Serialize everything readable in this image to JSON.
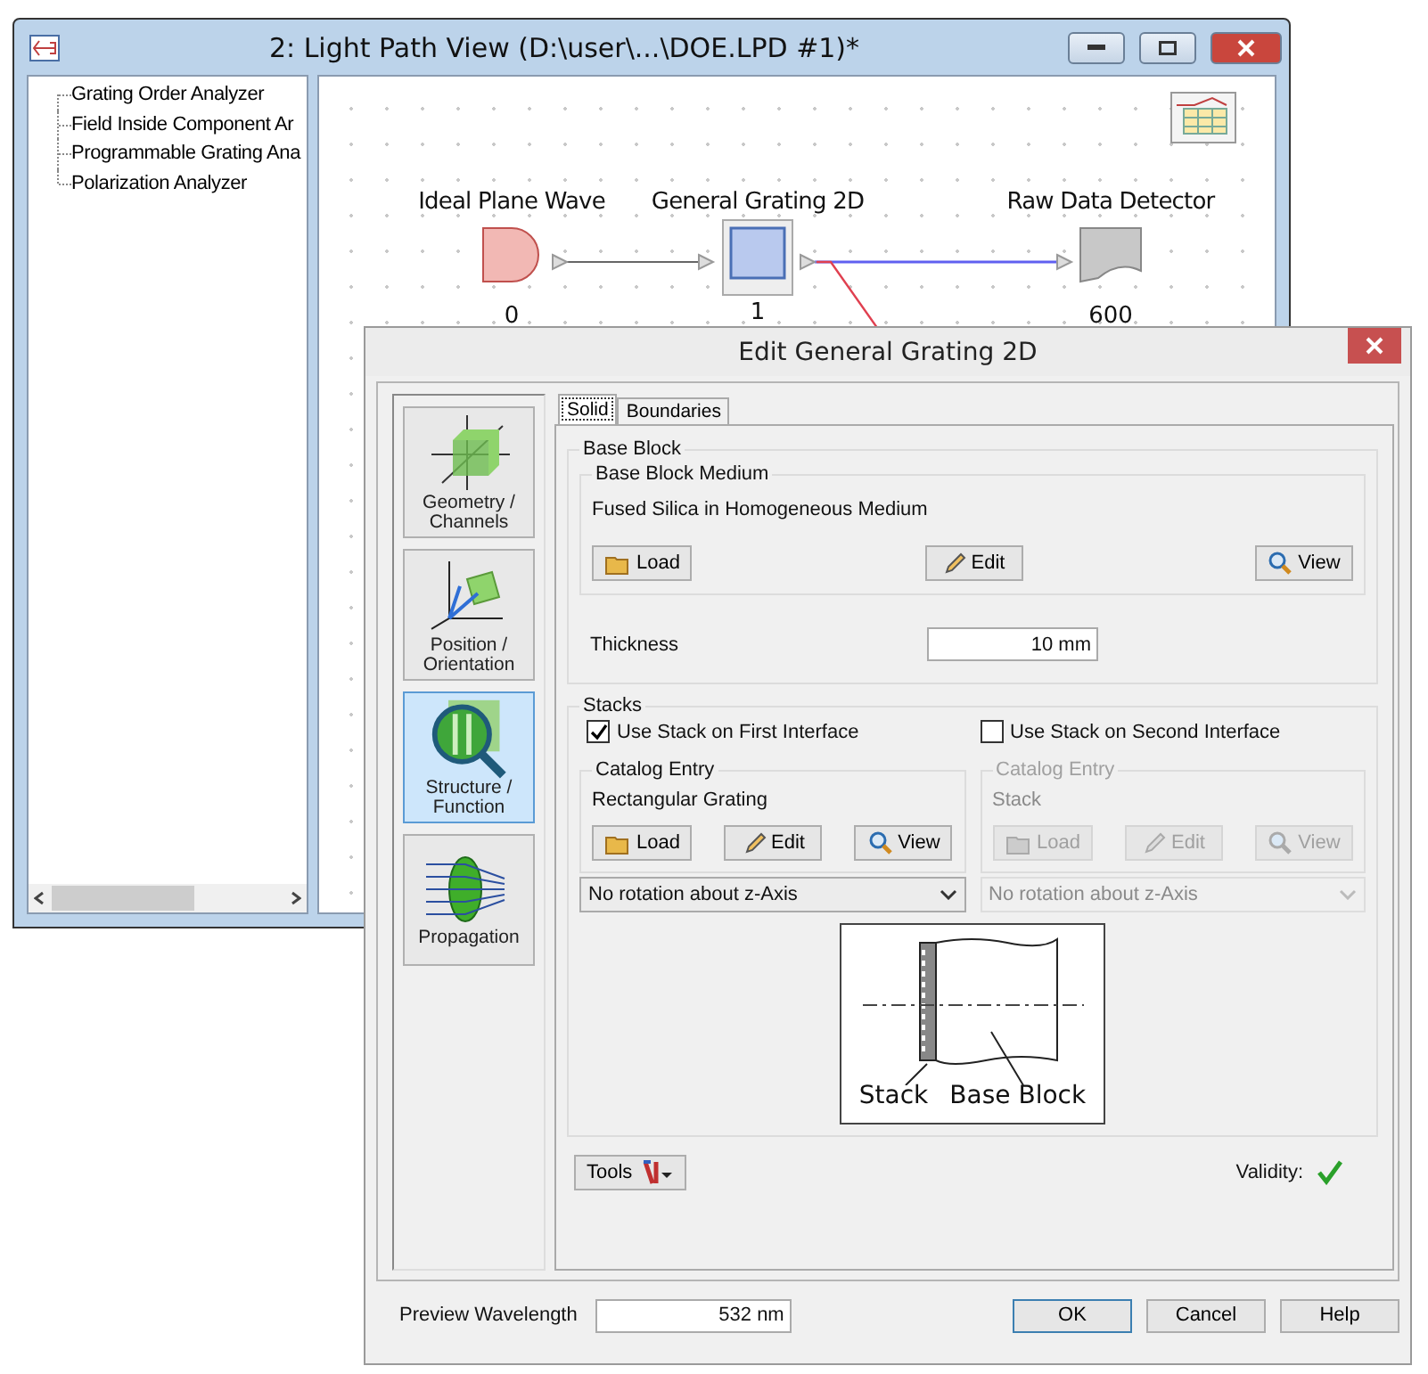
{
  "back_window": {
    "title": "2: Light Path View (D:\\user\\...\\DOE.LPD #1)*",
    "tree": [
      {
        "label": "Grating Order Analyzer"
      },
      {
        "label": "Field Inside Component Ar"
      },
      {
        "label": "Programmable Grating Ana"
      },
      {
        "label": "Polarization Analyzer"
      }
    ],
    "nodes": [
      {
        "label": "Ideal Plane Wave",
        "number": "0",
        "kind": "source",
        "selected": false
      },
      {
        "label": "General Grating 2D",
        "number": "1",
        "kind": "component",
        "selected": true
      },
      {
        "label": "Raw Data Detector",
        "number": "600",
        "kind": "detector",
        "selected": false
      }
    ]
  },
  "dialog": {
    "title": "Edit General Grating 2D",
    "nav": [
      {
        "label": "Geometry / Channels",
        "kind": "geometry",
        "selected": false
      },
      {
        "label": "Position / Orientation",
        "kind": "position",
        "selected": false
      },
      {
        "label": "Structure / Function",
        "kind": "structure",
        "selected": true
      },
      {
        "label": "Propagation",
        "kind": "propagation",
        "selected": false
      }
    ],
    "tabs": [
      {
        "label": "Solid",
        "selected": true
      },
      {
        "label": "Boundaries",
        "selected": false
      }
    ],
    "base_block": {
      "title": "Base Block",
      "medium_title": "Base Block Medium",
      "medium": "Fused Silica in Homogeneous Medium",
      "buttons": [
        {
          "label": "Load",
          "kind": "load"
        },
        {
          "label": "Edit",
          "kind": "edit"
        },
        {
          "label": "View",
          "kind": "view"
        }
      ],
      "thickness_label": "Thickness",
      "thickness": "10 mm"
    },
    "stacks": {
      "title": "Stacks",
      "interfaces": [
        {
          "label": "Use Stack on First Interface",
          "checked": true,
          "catalog_title": "Catalog Entry",
          "entry": "Rectangular Grating",
          "buttons": [
            {
              "label": "Load",
              "kind": "load"
            },
            {
              "label": "Edit",
              "kind": "edit"
            },
            {
              "label": "View",
              "kind": "view"
            }
          ],
          "rotation": "No rotation about z-Axis"
        },
        {
          "label": "Use Stack on Second Interface",
          "checked": false,
          "catalog_title": "Catalog Entry",
          "entry": "Stack",
          "buttons": [
            {
              "label": "Load",
              "kind": "load"
            },
            {
              "label": "Edit",
              "kind": "edit"
            },
            {
              "label": "View",
              "kind": "view"
            }
          ],
          "rotation": "No rotation about z-Axis"
        }
      ],
      "diagram_labels": [
        "Stack",
        "Base Block"
      ]
    },
    "tools": "Tools",
    "validity": "Validity:",
    "valid": true,
    "preview_label": "Preview Wavelength",
    "preview": "532 nm",
    "buttons": [
      {
        "label": "OK",
        "default": true
      },
      {
        "label": "Cancel",
        "default": false
      },
      {
        "label": "Help",
        "default": false
      }
    ]
  }
}
